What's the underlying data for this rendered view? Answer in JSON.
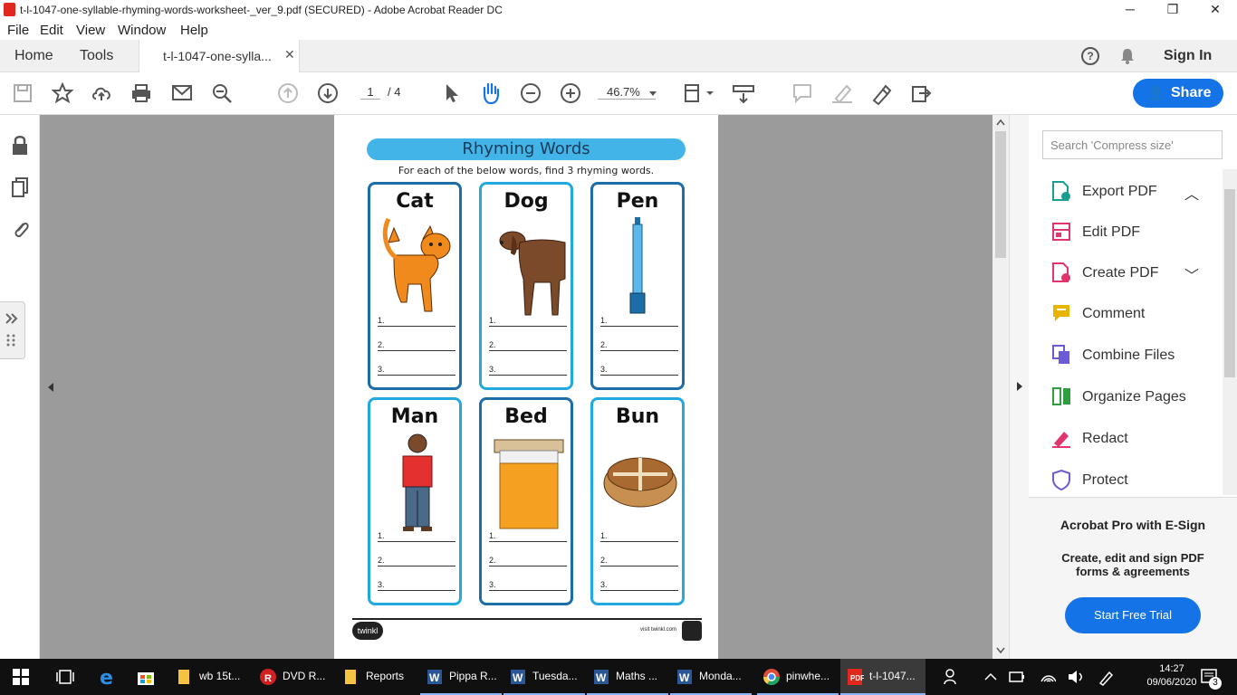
{
  "window": {
    "title": "t-l-1047-one-syllable-rhyming-words-worksheet-_ver_9.pdf (SECURED) - Adobe Acrobat Reader DC",
    "minimize": "─",
    "maximize": "❐",
    "close": "✕"
  },
  "menu": [
    "File",
    "Edit",
    "View",
    "Window",
    "Help"
  ],
  "tabs": {
    "home": "Home",
    "tools": "Tools",
    "document": "t-l-1047-one-sylla...",
    "close": "✕",
    "sign_in": "Sign In"
  },
  "toolbar": {
    "page_current": "1",
    "page_total": "/ 4",
    "zoom": "46.7%",
    "share": "Share"
  },
  "worksheet": {
    "title": "Rhyming Words",
    "subtitle": "For each of the below words, find 3 rhyming words.",
    "cards": [
      {
        "word": "Cat",
        "pen_text": ""
      },
      {
        "word": "Dog"
      },
      {
        "word": "Pen"
      },
      {
        "word": "Man"
      },
      {
        "word": "Bed"
      },
      {
        "word": "Bun"
      }
    ],
    "line_labels": [
      "1.",
      "2.",
      "3."
    ],
    "logo": "twinkl",
    "footer_url": "visit twinkl.com"
  },
  "right_panel": {
    "search_placeholder": "Search 'Compress size'",
    "tools": [
      {
        "label": "Export PDF",
        "icon": "export-pdf-icon",
        "color": "#1a9e8f"
      },
      {
        "label": "Edit PDF",
        "icon": "edit-pdf-icon",
        "color": "#e0366d"
      },
      {
        "label": "Create PDF",
        "icon": "create-pdf-icon",
        "color": "#e0366d"
      },
      {
        "label": "Comment",
        "icon": "comment-icon",
        "color": "#e8b400"
      },
      {
        "label": "Combine Files",
        "icon": "combine-files-icon",
        "color": "#6b5bd6"
      },
      {
        "label": "Organize Pages",
        "icon": "organize-pages-icon",
        "color": "#2e9e3e"
      },
      {
        "label": "Redact",
        "icon": "redact-icon",
        "color": "#e0366d"
      },
      {
        "label": "Protect",
        "icon": "protect-icon",
        "color": "#6b5bd6"
      }
    ],
    "promo_title": "Acrobat Pro with E-Sign",
    "promo_desc": "Create, edit and sign PDF forms & agreements",
    "promo_button": "Start Free Trial"
  },
  "taskbar": {
    "items": [
      {
        "label": "wb 15t...",
        "icon": "folder-icon"
      },
      {
        "label": "DVD R...",
        "icon": "dvd-app-icon"
      },
      {
        "label": "Reports",
        "icon": "folder-icon"
      },
      {
        "label": "Pippa R...",
        "icon": "word-icon"
      },
      {
        "label": "Tuesda...",
        "icon": "word-icon"
      },
      {
        "label": "Maths ...",
        "icon": "word-icon"
      },
      {
        "label": "Monda...",
        "icon": "word-icon"
      },
      {
        "label": "pinwhe...",
        "icon": "chrome-icon"
      },
      {
        "label": "t-l-1047...",
        "icon": "acrobat-icon"
      }
    ],
    "time": "14:27",
    "date": "09/06/2020",
    "notifications": "3"
  }
}
